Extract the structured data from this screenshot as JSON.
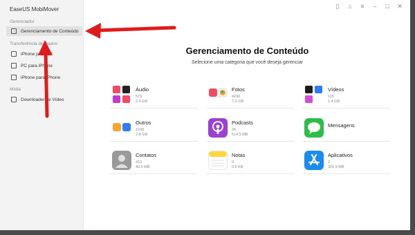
{
  "app": {
    "title": "EaseUS MobiMover"
  },
  "sidebar": {
    "sections": [
      {
        "label": "Gerenciador"
      },
      {
        "label": "Transferência de Dados"
      },
      {
        "label": "Mídia"
      }
    ],
    "items": [
      {
        "label": "Gerenciamento de Conteúdo",
        "active": true
      },
      {
        "label": "iPhone para PC"
      },
      {
        "label": "PC para iPhone"
      },
      {
        "label": "iPhone para iPhone"
      },
      {
        "label": "Downloader de Vídeo"
      }
    ]
  },
  "main": {
    "title": "Gerenciamento de Conteúdo",
    "subtitle": "Selecione uma categoria que você deseja gerenciar",
    "categories": [
      {
        "name": "Áudio",
        "count": "576",
        "size": "2.4 GB",
        "icon": "audio-apps-icon",
        "color": "#f2f2f2"
      },
      {
        "name": "Fotos",
        "count": "4290",
        "size": "7.2 GB",
        "icon": "photos-icon",
        "color": "#f2f2f2"
      },
      {
        "name": "Vídeos",
        "count": "115",
        "size": "1.4 GB",
        "icon": "videos-icon",
        "color": "#f2f2f2"
      },
      {
        "name": "Outros",
        "count": "1243",
        "size": "2.8 GB",
        "icon": "others-icon",
        "color": "#f7a531"
      },
      {
        "name": "Podcasts",
        "count": "26",
        "size": "514.5 MB",
        "icon": "podcasts-icon",
        "color": "#9b3fd6"
      },
      {
        "name": "Mensagens",
        "count": "",
        "size": "",
        "icon": "messages-icon",
        "color": "#2dbe4a"
      },
      {
        "name": "Contatos",
        "count": "410",
        "size": "40.0 MB",
        "icon": "contacts-icon",
        "color": "#9a9a9a"
      },
      {
        "name": "Notas",
        "count": "0",
        "size": "0.0 KB",
        "icon": "notes-icon",
        "color": "#ffd73a"
      },
      {
        "name": "Aplicativos",
        "count": "2",
        "size": "326.9 MB",
        "icon": "app-store-icon",
        "color": "#1a8cf0"
      }
    ]
  },
  "colors": {
    "arrow": "#e01b1b",
    "sidebar_bg": "#f3f3f3"
  }
}
